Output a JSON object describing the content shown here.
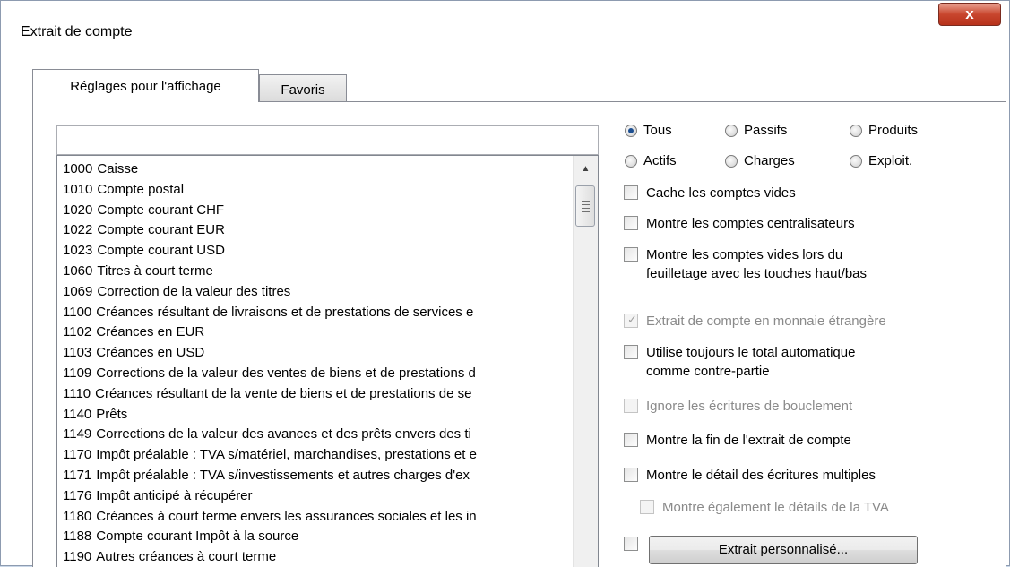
{
  "window": {
    "title": "Extrait de compte",
    "close_label": "x"
  },
  "tabs": [
    {
      "label": "Réglages pour l'affichage",
      "active": true
    },
    {
      "label": "Favoris",
      "active": false
    }
  ],
  "search": {
    "value": "",
    "placeholder": ""
  },
  "accounts": [
    {
      "number": "1000",
      "name": "Caisse"
    },
    {
      "number": "1010",
      "name": "Compte postal"
    },
    {
      "number": "1020",
      "name": "Compte courant CHF"
    },
    {
      "number": "1022",
      "name": "Compte courant EUR"
    },
    {
      "number": "1023",
      "name": "Compte courant USD"
    },
    {
      "number": "1060",
      "name": "Titres à court terme"
    },
    {
      "number": "1069",
      "name": "Correction de la valeur des titres"
    },
    {
      "number": "1100",
      "name": "Créances résultant de livraisons et de prestations de services e"
    },
    {
      "number": "1102",
      "name": "Créances en EUR"
    },
    {
      "number": "1103",
      "name": "Créances en USD"
    },
    {
      "number": "1109",
      "name": "Corrections de la valeur des ventes de biens et de prestations d"
    },
    {
      "number": "1110",
      "name": "Créances résultant de la vente de biens et de prestations de se"
    },
    {
      "number": "1140",
      "name": "Prêts"
    },
    {
      "number": "1149",
      "name": "Corrections de la valeur des avances et des prêts envers des ti"
    },
    {
      "number": "1170",
      "name": "Impôt préalable : TVA s/matériel, marchandises, prestations et e"
    },
    {
      "number": "1171",
      "name": "Impôt préalable : TVA s/investissements et autres charges d'ex"
    },
    {
      "number": "1176",
      "name": "Impôt anticipé à récupérer"
    },
    {
      "number": "1180",
      "name": "Créances à court terme envers les assurances sociales et les in"
    },
    {
      "number": "1188",
      "name": "Compte courant Impôt à la source"
    },
    {
      "number": "1190",
      "name": "Autres créances à court terme"
    }
  ],
  "filters": [
    {
      "label": "Tous",
      "selected": true
    },
    {
      "label": "Passifs",
      "selected": false
    },
    {
      "label": "Produits",
      "selected": false
    },
    {
      "label": "Actifs",
      "selected": false
    },
    {
      "label": "Charges",
      "selected": false
    },
    {
      "label": "Exploit.",
      "selected": false
    }
  ],
  "options": {
    "hide_empty": {
      "label": "Cache les comptes vides",
      "checked": false,
      "enabled": true
    },
    "show_centralizing": {
      "label": "Montre les comptes centralisateurs",
      "checked": false,
      "enabled": true
    },
    "show_empty_paging_line1": "Montre les comptes vides lors du",
    "show_empty_paging_line2": "feuilletage avec les touches haut/bas",
    "foreign_currency": {
      "label": "Extrait de compte en monnaie étrangère",
      "checked": true,
      "enabled": false
    },
    "auto_total_line1": "Utilise toujours le total automatique",
    "auto_total_line2": "comme contre-partie",
    "ignore_closing": {
      "label": "Ignore les écritures de bouclement",
      "checked": false,
      "enabled": false
    },
    "show_end": {
      "label": "Montre la fin de l'extrait de compte",
      "checked": false,
      "enabled": true
    },
    "show_multi_detail": {
      "label": "Montre le détail des écritures multiples",
      "checked": false,
      "enabled": true
    },
    "show_vat_detail": {
      "label": "Montre également le détails de la TVA",
      "checked": false,
      "enabled": false
    }
  },
  "custom_extract_button": "Extrait personnalisé..."
}
